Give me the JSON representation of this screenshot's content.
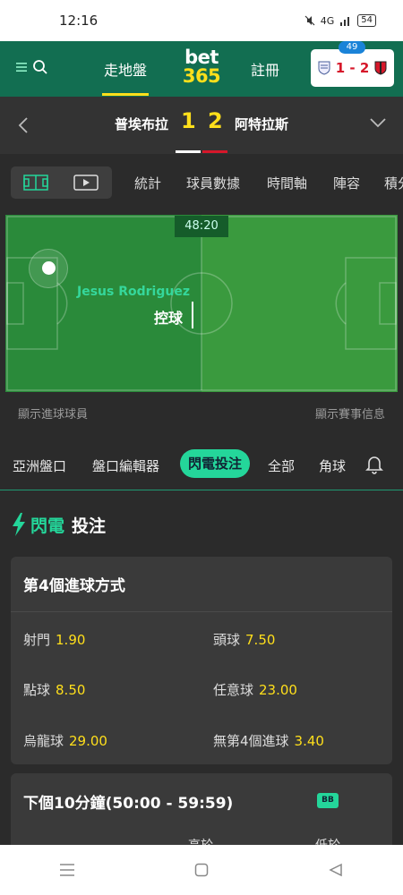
{
  "status_bar": {
    "time": "12:16",
    "battery": "54",
    "signal": "4G"
  },
  "header": {
    "in_play": "走地盤",
    "logo_top": "bet",
    "logo_bottom": "365",
    "register": "註冊",
    "score_badge": "49",
    "mini_score": "1 - 2"
  },
  "match": {
    "home_team": "普埃布拉",
    "away_team": "阿特拉斯",
    "home_score": "1",
    "away_score": "2"
  },
  "sub_tabs": [
    "統計",
    "球員數據",
    "時間軸",
    "陣容",
    "積分"
  ],
  "pitch": {
    "timer": "48:20",
    "player": "Jesus Rodriguez",
    "action": "控球"
  },
  "pitch_links": {
    "show_scorers": "顯示進球球員",
    "show_match_info": "顯示賽事信息"
  },
  "market_tabs": [
    "亞洲盤口",
    "盤口編輯器",
    "閃電投注",
    "全部",
    "角球"
  ],
  "flash": {
    "flash_word": "閃電",
    "bet_word": "投注"
  },
  "card1": {
    "title": "第4個進球方式",
    "odds": [
      {
        "label": "射門",
        "price": "1.90"
      },
      {
        "label": "頭球",
        "price": "7.50"
      },
      {
        "label": "點球",
        "price": "8.50"
      },
      {
        "label": "任意球",
        "price": "23.00"
      },
      {
        "label": "烏龍球",
        "price": "29.00"
      },
      {
        "label": "無第4個進球",
        "price": "3.40"
      }
    ]
  },
  "card2": {
    "title": "下個10分鐘(50:00 - 59:59)",
    "badge": "BB",
    "col_high": "高於",
    "col_low": "低於"
  },
  "colors": {
    "brand_green": "#126e51",
    "accent_yellow": "#ffdf1b",
    "flash_green": "#24d69a",
    "away_red": "#d6172a"
  }
}
